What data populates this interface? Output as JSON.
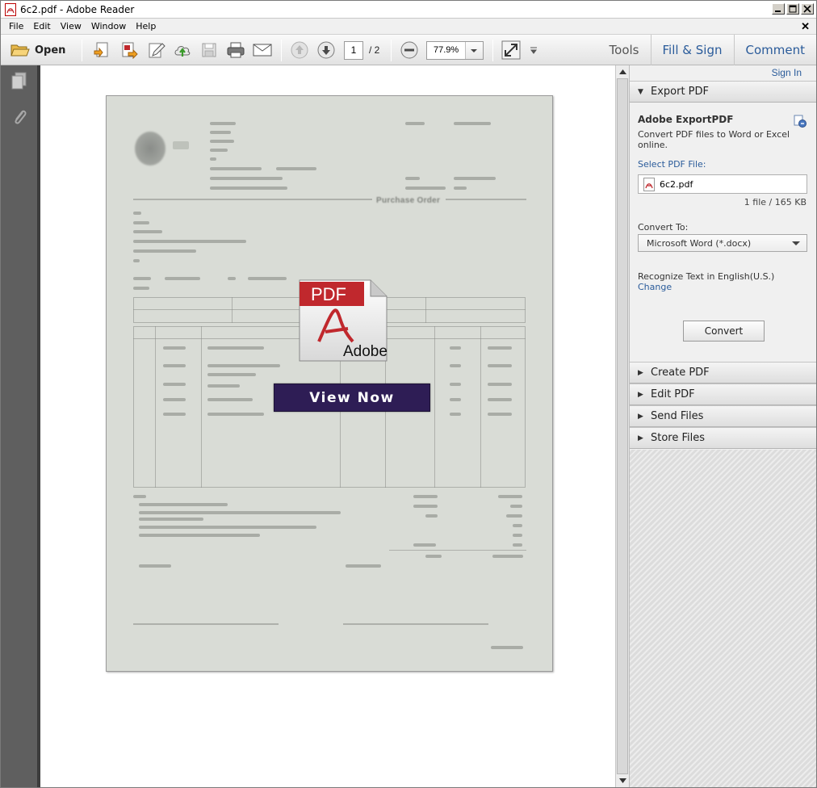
{
  "window": {
    "title": "6c2.pdf - Adobe Reader"
  },
  "menubar": {
    "items": [
      "File",
      "Edit",
      "View",
      "Window",
      "Help"
    ]
  },
  "toolbar": {
    "open_label": "Open",
    "page_current": "1",
    "page_total": "/ 2",
    "zoom": "77.9%",
    "tabs": [
      "Tools",
      "Fill & Sign",
      "Comment"
    ]
  },
  "document": {
    "overlay_button": "View Now",
    "pdf_badge_top": "PDF",
    "pdf_badge_bottom": "Adobe",
    "blurred_heading": "Purchase Order"
  },
  "rightpanel": {
    "signin": "Sign In",
    "export": {
      "header": "Export PDF",
      "title": "Adobe ExportPDF",
      "description": "Convert PDF files to Word or Excel online.",
      "select_label": "Select PDF File:",
      "file_name": "6c2.pdf",
      "file_count": "1 file / 165 KB",
      "convert_to_label": "Convert To:",
      "convert_to_value": "Microsoft Word (*.docx)",
      "recognize": "Recognize Text in English(U.S.)",
      "change": "Change",
      "convert_button": "Convert"
    },
    "sections": [
      "Create PDF",
      "Edit PDF",
      "Send Files",
      "Store Files"
    ]
  },
  "colors": {
    "accent_link": "#2a5b9a",
    "view_now_bg": "#2e1d55",
    "pdf_red": "#c0282d"
  }
}
